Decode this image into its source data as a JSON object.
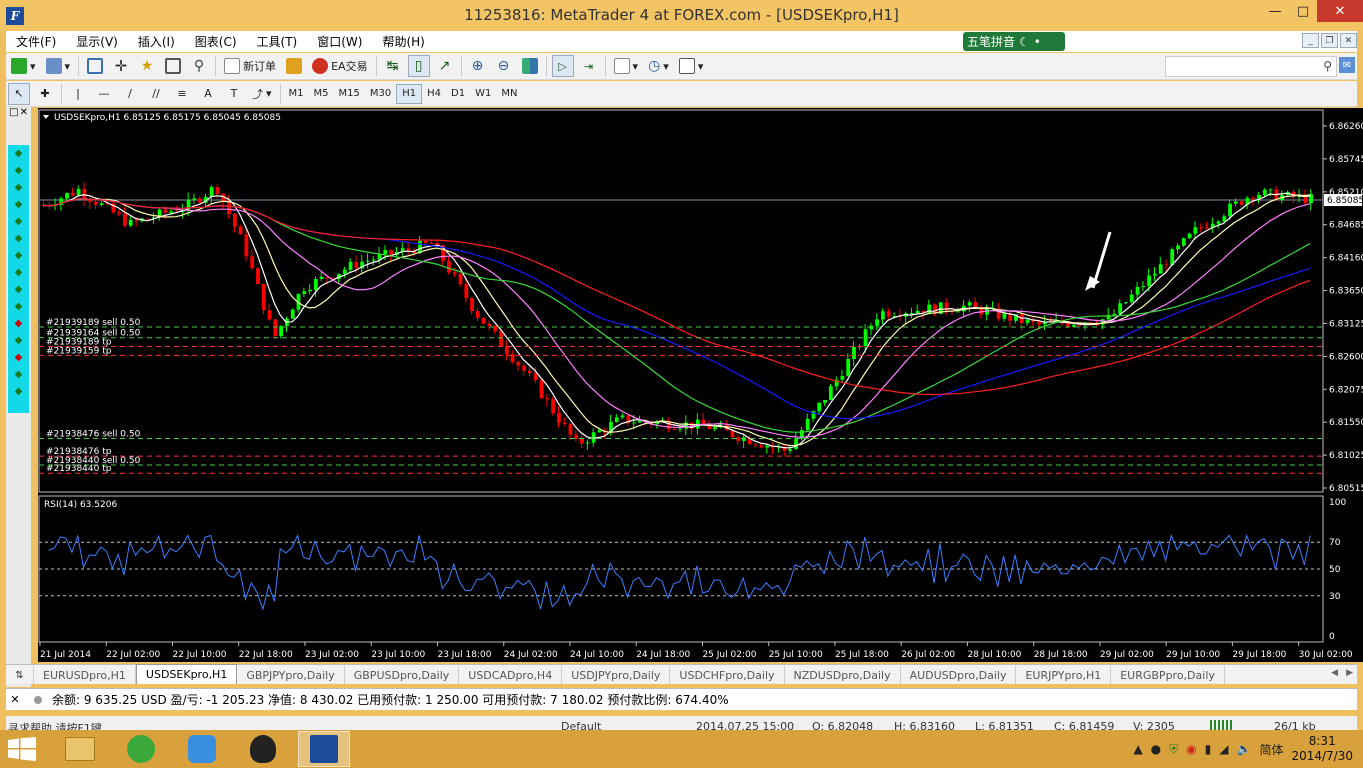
{
  "window": {
    "title": "11253816: MetaTrader 4 at FOREX.com - [USDSEKpro,H1]",
    "app_icon": "F"
  },
  "menu": {
    "items": [
      "文件(F)",
      "显示(V)",
      "插入(I)",
      "图表(C)",
      "工具(T)",
      "窗口(W)",
      "帮助(H)"
    ]
  },
  "ime": {
    "label": "五笔拼音"
  },
  "toolbar": {
    "new_order": "新订单",
    "ea_trade": "EA交易"
  },
  "timeframes": [
    "M1",
    "M5",
    "M15",
    "M30",
    "H1",
    "H4",
    "D1",
    "W1",
    "MN"
  ],
  "selected_timeframe": "H1",
  "chart": {
    "header": "USDSEKpro,H1  6.85125 6.85175 6.85045 6.85085",
    "current_price": "6.85085",
    "price_labels": [
      "6.86260",
      "6.85745",
      "6.85210",
      "6.84685",
      "6.84160",
      "6.83650",
      "6.83125",
      "6.82600",
      "6.82075",
      "6.81550",
      "6.81025",
      "6.80515"
    ],
    "time_labels": [
      "21 Jul 2014",
      "22 Jul 02:00",
      "22 Jul 10:00",
      "22 Jul 18:00",
      "23 Jul 02:00",
      "23 Jul 10:00",
      "23 Jul 18:00",
      "24 Jul 02:00",
      "24 Jul 10:00",
      "24 Jul 18:00",
      "25 Jul 02:00",
      "25 Jul 10:00",
      "25 Jul 18:00",
      "26 Jul 02:00",
      "28 Jul 10:00",
      "28 Jul 18:00",
      "29 Jul 02:00",
      "29 Jul 10:00",
      "29 Jul 18:00",
      "30 Jul 02:00"
    ],
    "order_labels": [
      "#21939189 sell 0.50",
      "#21939164 sell 0.50",
      "#21939189 tp",
      "#21939159 tp",
      "#21938476 sell 0.50",
      "#21938476 tp",
      "#21938440 sell 0.50",
      "#21938440 tp"
    ],
    "rsi_header": "RSI(14) 63.5206",
    "rsi_labels": [
      "100",
      "70",
      "50",
      "30",
      "0"
    ]
  },
  "tabs": [
    "EURUSDpro,H1",
    "USDSEKpro,H1",
    "GBPJPYpro,Daily",
    "GBPUSDpro,Daily",
    "USDCADpro,H4",
    "USDJPYpro,Daily",
    "USDCHFpro,Daily",
    "NZDUSDpro,Daily",
    "AUDUSDpro,Daily",
    "EURJPYpro,H1",
    "EURGBPpro,Daily"
  ],
  "active_tab": "USDSEKpro,H1",
  "terminal": {
    "text": "余额: 9 635.25 USD   盈/亏: -1 205.23   净值: 8 430.02   已用预付款: 1 250.00   可用预付款: 7 180.02   预付款比例: 674.40%"
  },
  "status": {
    "help": "寻求帮助,请按F1键",
    "profile": "Default",
    "datetime": "2014.07.25 15:00",
    "open": "O: 6.82048",
    "high": "H: 6.83160",
    "low": "L: 6.81351",
    "close": "C: 6.81459",
    "volume": "V: 2305",
    "traffic": "26/1 kb"
  },
  "taskbar": {
    "ime_lang": "简体",
    "time": "8:31",
    "date": "2014/7/30"
  },
  "colors": {
    "bull": "#00ff00",
    "bear": "#ff0000",
    "bg": "#000000",
    "ma_fast": "#ffffff",
    "ma_slow_blue": "#1a1aff",
    "ma_red": "#ff2020",
    "rsi": "#3d7fff"
  }
}
